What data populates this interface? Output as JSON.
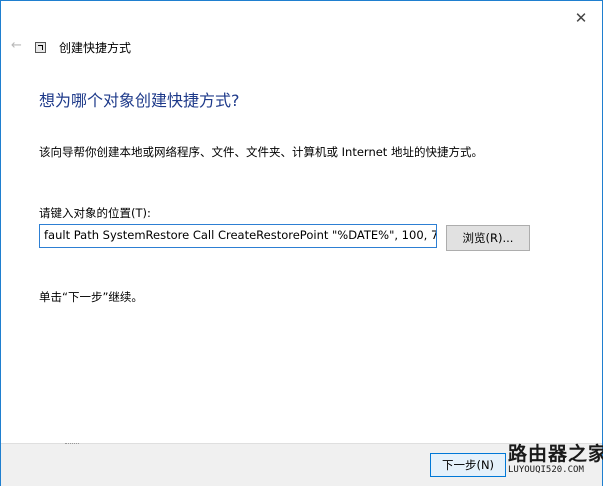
{
  "window": {
    "title": "创建快捷方式",
    "close_glyph": "✕",
    "back_glyph": "←"
  },
  "main": {
    "heading": "想为哪个对象创建快捷方式?",
    "description": "该向导帮你创建本地或网络程序、文件、文件夹、计算机或 Internet 地址的快捷方式。",
    "field_label": "请键入对象的位置(T):",
    "location_value": "fault Path SystemRestore Call CreateRestorePoint \"%DATE%\", 100, 7",
    "browse_label": "浏览(R)...",
    "instruction": "单击“下一步”继续。"
  },
  "footer": {
    "next_label": "下一步(N)"
  },
  "watermark": {
    "text": "路由器之家",
    "url": "LUYOUQI520.COM"
  },
  "icons": [
    "back-arrow-icon",
    "wizard-shortcut-icon",
    "close-icon"
  ]
}
